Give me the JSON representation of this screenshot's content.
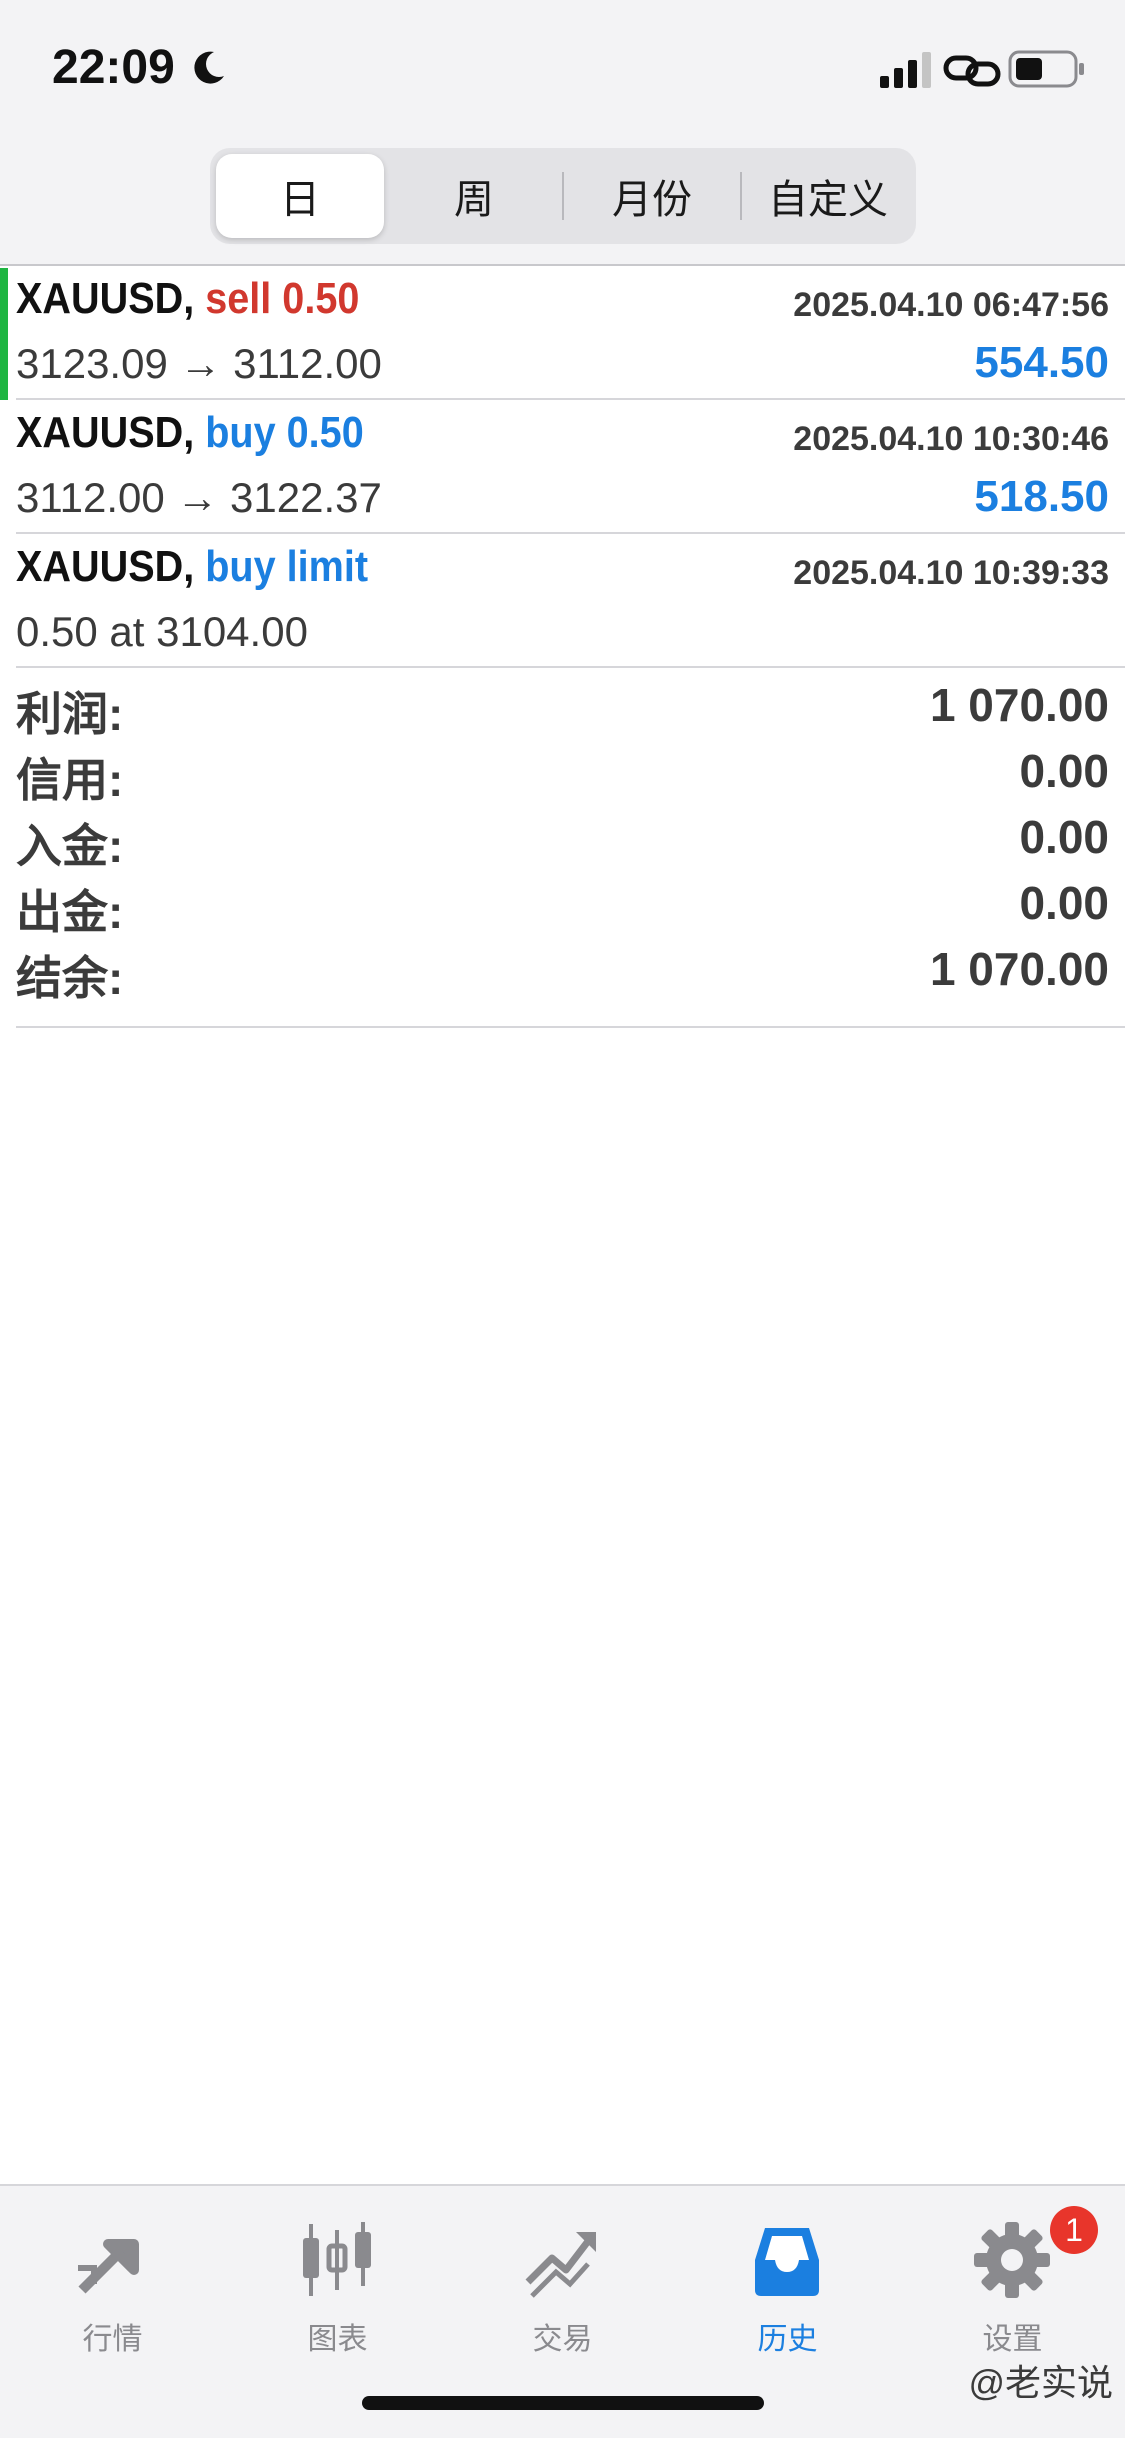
{
  "status_bar": {
    "time": "22:09",
    "icons": [
      "moon-icon",
      "signal-icon",
      "link-icon",
      "battery-icon"
    ]
  },
  "segments": [
    {
      "label": "日",
      "active": true
    },
    {
      "label": "周",
      "active": false
    },
    {
      "label": "月份",
      "active": false
    },
    {
      "label": "自定义",
      "active": false
    }
  ],
  "trades": [
    {
      "symbol": "XAUUSD,",
      "direction": "sell 0.50",
      "direction_type": "sell",
      "time": "2025.04.10 06:47:56",
      "prices": "3123.09 → 3112.00",
      "profit": "554.50"
    },
    {
      "symbol": "XAUUSD,",
      "direction": "buy 0.50",
      "direction_type": "buy",
      "time": "2025.04.10 10:30:46",
      "prices": "3112.00 → 3122.37",
      "profit": "518.50"
    },
    {
      "symbol": "XAUUSD,",
      "direction": "buy limit",
      "direction_type": "buy",
      "time": "2025.04.10 10:39:33",
      "prices": "0.50 at 3104.00",
      "profit": ""
    }
  ],
  "summary": [
    {
      "label": "利润:",
      "value": "1 070.00"
    },
    {
      "label": "信用:",
      "value": "0.00"
    },
    {
      "label": "入金:",
      "value": "0.00"
    },
    {
      "label": "出金:",
      "value": "0.00"
    },
    {
      "label": "结余:",
      "value": "1 070.00"
    }
  ],
  "tabs": [
    {
      "label": "行情",
      "icon": "quotes-icon",
      "active": false
    },
    {
      "label": "图表",
      "icon": "chart-icon",
      "active": false
    },
    {
      "label": "交易",
      "icon": "trade-icon",
      "active": false
    },
    {
      "label": "历史",
      "icon": "history-icon",
      "active": true
    },
    {
      "label": "设置",
      "icon": "settings-icon",
      "active": false,
      "badge": "1"
    }
  ],
  "watermark": "@老实说",
  "colors": {
    "sell": "#d1382e",
    "buy": "#1b7fe0",
    "profit": "#1b7fe0",
    "accent_bar": "#1fb542",
    "tab_active": "#1b7fe0",
    "badge": "#e8352b"
  }
}
